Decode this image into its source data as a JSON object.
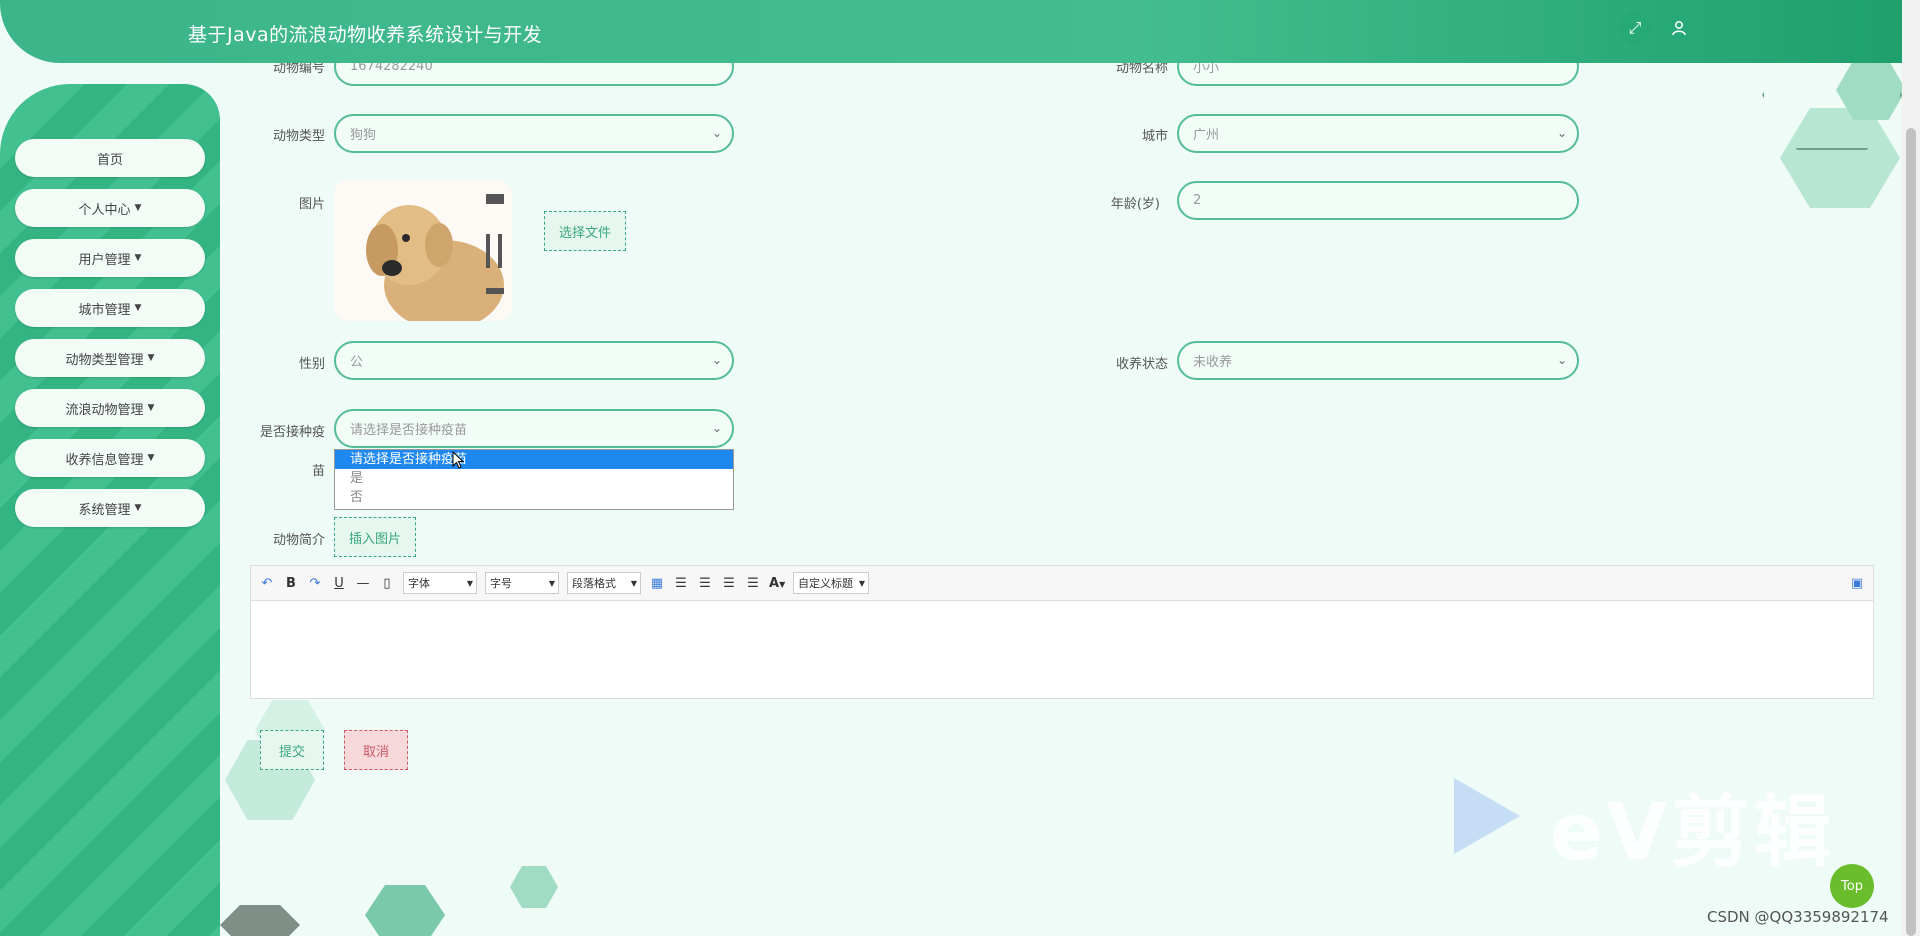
{
  "header": {
    "title": "基于Java的流浪动物收养系统设计与开发"
  },
  "sidebar": {
    "items": [
      {
        "label": "首页",
        "has_caret": false
      },
      {
        "label": "个人中心",
        "has_caret": true
      },
      {
        "label": "用户管理",
        "has_caret": true
      },
      {
        "label": "城市管理",
        "has_caret": true
      },
      {
        "label": "动物类型管理",
        "has_caret": true
      },
      {
        "label": "流浪动物管理",
        "has_caret": true
      },
      {
        "label": "收养信息管理",
        "has_caret": true
      },
      {
        "label": "系统管理",
        "has_caret": true
      }
    ]
  },
  "form": {
    "animal_no": {
      "label": "动物编号",
      "value": "1674282240"
    },
    "animal_name": {
      "label": "动物名称",
      "value": "小小"
    },
    "animal_type": {
      "label": "动物类型",
      "value": "狗狗"
    },
    "city": {
      "label": "城市",
      "value": "广州"
    },
    "image": {
      "label": "图片",
      "choose_file": "选择文件"
    },
    "age": {
      "label": "年龄(岁)",
      "value": "2"
    },
    "gender": {
      "label": "性别",
      "value": "公"
    },
    "adopt_status": {
      "label": "收养状态",
      "value": "未收养"
    },
    "vaccinated": {
      "label_line1": "是否接种疫",
      "label_line2": "苗",
      "placeholder": "请选择是否接种疫苗",
      "options": [
        "请选择是否接种疫苗",
        "是",
        "否"
      ]
    },
    "intro": {
      "label": "动物简介",
      "insert_image": "插入图片"
    }
  },
  "editor": {
    "font_family": "字体",
    "font_size": "字号",
    "paragraph": "段落格式",
    "custom_title": "自定义标题"
  },
  "actions": {
    "submit": "提交",
    "cancel": "取消"
  },
  "misc": {
    "top": "Top",
    "watermark": "eV剪辑",
    "credit": "CSDN @QQ3359892174"
  }
}
